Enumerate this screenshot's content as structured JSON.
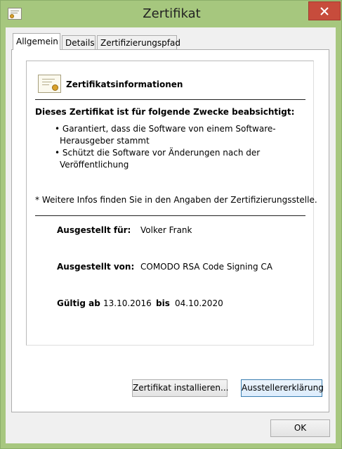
{
  "window": {
    "title": "Zertifikat",
    "title_icon": "certificate-icon",
    "close_icon": "close-icon"
  },
  "tabs": [
    {
      "label": "Allgemein",
      "active": true
    },
    {
      "label": "Details",
      "active": false
    },
    {
      "label": "Zertifizierungspfad",
      "active": false
    }
  ],
  "certificate": {
    "heading": "Zertifikatsinformationen",
    "purpose_heading": "Dieses Zertifikat ist für folgende Zwecke beabsichtigt:",
    "purposes": [
      "Garantiert, dass die Software von einem Software-Herausgeber stammt",
      "Schützt die Software vor Änderungen nach der Veröffentlichung"
    ],
    "note": "* Weitere Infos finden Sie in den Angaben der Zertifizierungsstelle.",
    "issued_to_label": "Ausgestellt für:",
    "issued_to": "Volker Frank",
    "issued_by_label": "Ausgestellt von:",
    "issued_by": "COMODO RSA Code Signing CA",
    "valid_from_label": "Gültig ab",
    "valid_from": "13.10.2016",
    "valid_to_label": "bis",
    "valid_to": "04.10.2020"
  },
  "buttons": {
    "install": "Zertifikat installieren...",
    "issuer_statement": "Ausstellererklärung",
    "ok": "OK"
  },
  "colors": {
    "titlebar": "#a6c77e",
    "close": "#c74c3c",
    "focus_border": "#3c7fb1"
  }
}
